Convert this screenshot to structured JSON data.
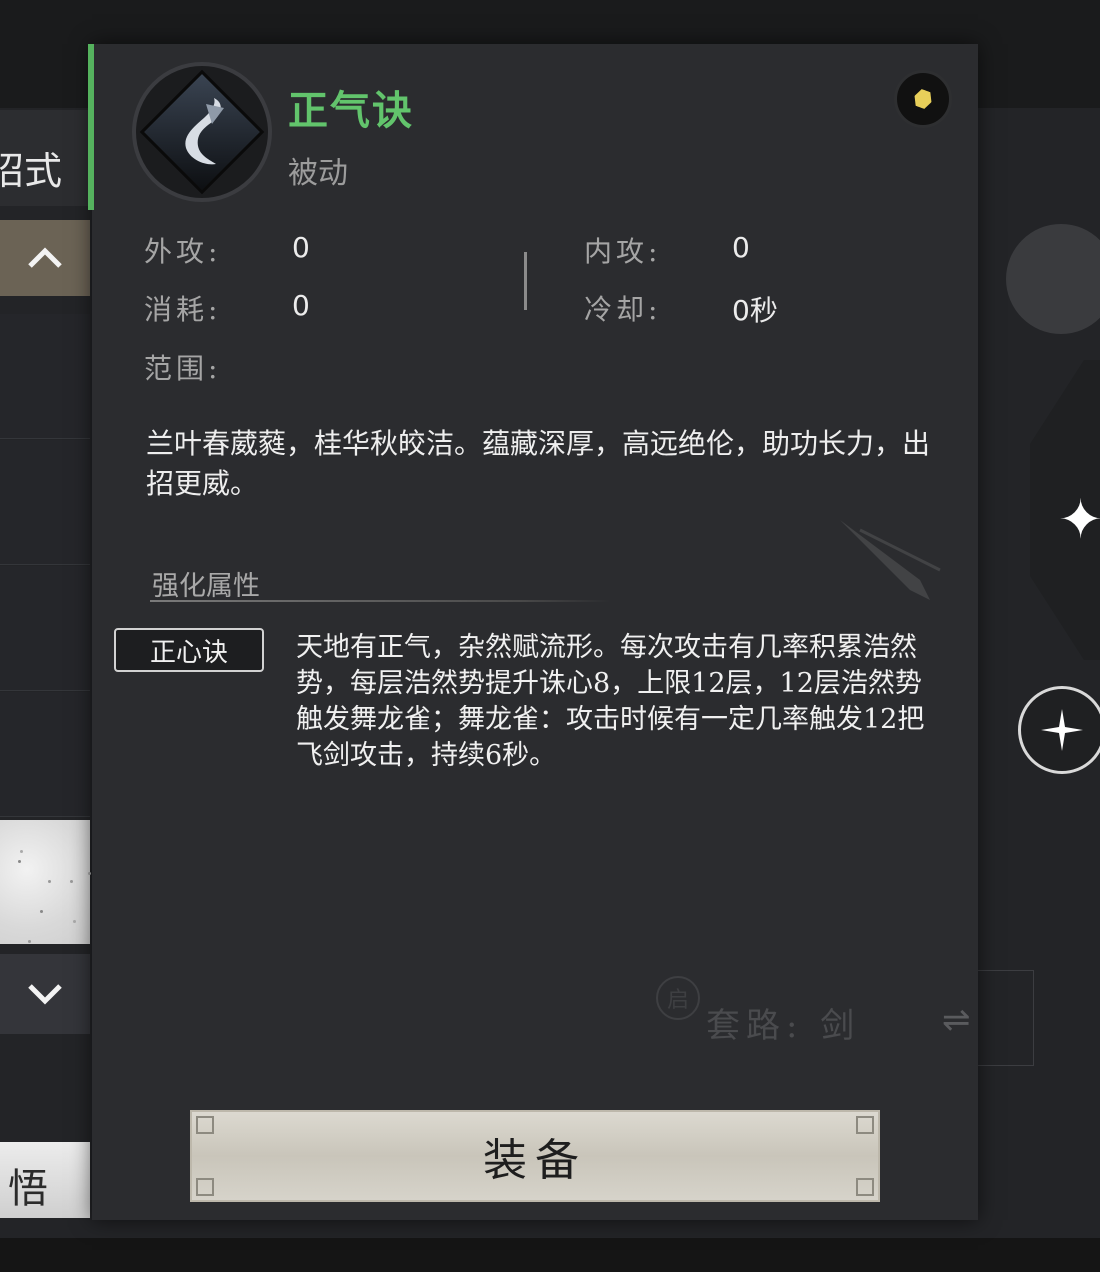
{
  "left_panel": {
    "tab_label": "招式",
    "scroll_up_icon": "chevron-up-icon",
    "scroll_down_icon": "chevron-down-icon",
    "bottom_item_label": "悟"
  },
  "skill": {
    "name": "正气诀",
    "type": "被动",
    "name_color": "#62c46c",
    "icon": "sword-skill-icon"
  },
  "stats": {
    "outer_attack_label": "外攻:",
    "outer_attack_value": "0",
    "inner_attack_label": "内攻:",
    "inner_attack_value": "0",
    "cost_label": "消耗:",
    "cost_value": "0",
    "cooldown_label": "冷却:",
    "cooldown_value": "0秒",
    "range_label": "范围:"
  },
  "description": "兰叶春葳蕤，桂华秋皎洁。蕴藏深厚，高远绝伦，助功长力，出招更威。",
  "enhancement": {
    "title": "强化属性",
    "tag": "正心诀",
    "text": "天地有正气，杂然赋流形。每次攻击有几率积累浩然势，每层浩然势提升诛心8，上限12层，12层浩然势触发舞龙雀；舞龙雀：攻击时候有一定几率触发12把飞剑攻击，持续6秒。"
  },
  "background_ui": {
    "taolu_badge": "启",
    "taolu_text": "套路: 剑"
  },
  "equip_button_label": "装备"
}
